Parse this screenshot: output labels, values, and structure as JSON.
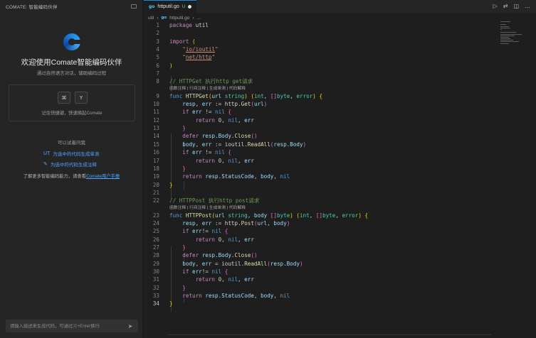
{
  "panel": {
    "title": "COMATE: 智能编码伙伴",
    "welcome_title": "欢迎使用Comate智能编码伙伴",
    "welcome_subtitle": "通过自然语言对话，辅助编码过程",
    "shortcut_keys": [
      "⌘",
      "Y"
    ],
    "shortcut_hint": "记住快捷键，快速唤起Comate",
    "try_title": "可以试着问我",
    "try_items": [
      "为选中的代码生成单测",
      "为选中的代码生成注释"
    ],
    "learn_text": "了解更多智能编码能力，请查看",
    "learn_link": "Comate用户手册",
    "input_placeholder": "请输入描述来生成代码，可通过⌘+Enter换行"
  },
  "editor": {
    "tab": {
      "file": "httputil.go",
      "status": "U",
      "lang_icon": "go"
    },
    "breadcrumb": [
      "util",
      "httputil.go",
      "..."
    ],
    "codelens": "函数注释 | 行间注释 | 生成单测 | 代码解释",
    "line_numbers": [
      "1",
      "2",
      "3",
      "4",
      "5",
      "6",
      "7",
      "8",
      "9",
      "10",
      "11",
      "12",
      "13",
      "14",
      "15",
      "16",
      "17",
      "18",
      "19",
      "20",
      "21",
      "22",
      "23",
      "24",
      "25",
      "26",
      "27",
      "28",
      "29",
      "30",
      "31",
      "32",
      "33",
      "34"
    ]
  },
  "colors": {
    "accent": "#1e88e5",
    "link": "#4fa3ff",
    "keyword": "#c586c0",
    "string": "#ce9178",
    "comment": "#6a9955",
    "function": "#dcdcaa"
  }
}
